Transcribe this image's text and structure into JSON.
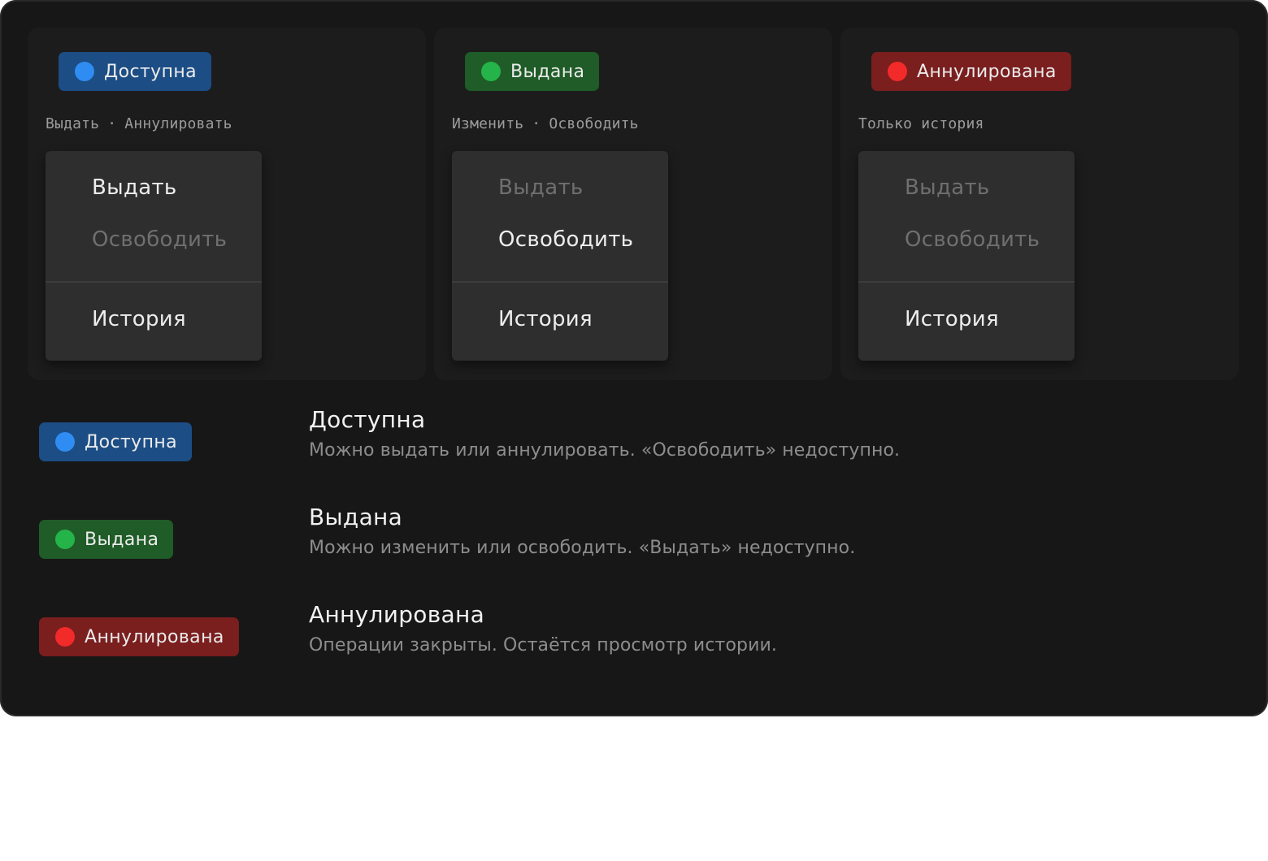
{
  "colors": {
    "background": "#171717",
    "card": "#1c1c1c",
    "menu": "#2e2e2e",
    "available": "#1c4d85",
    "available_dot": "#2f8cf2",
    "issued": "#1f5c27",
    "issued_dot": "#25b449",
    "cancelled": "#7a1e1e",
    "cancelled_dot": "#f22a2a"
  },
  "cards": [
    {
      "status": "Доступна",
      "status_color": "blue",
      "dot_icon": "status-dot-icon",
      "hint_parts": [
        "Выдать",
        "·",
        "Аннулировать"
      ],
      "menu": {
        "issue": "Выдать",
        "issue_enabled": true,
        "release": "Освободить",
        "release_enabled": false,
        "history": "История"
      }
    },
    {
      "status": "Выдана",
      "status_color": "green",
      "dot_icon": "status-dot-icon",
      "hint_parts": [
        "Изменить",
        "·",
        "Освободить"
      ],
      "menu": {
        "issue": "Выдать",
        "issue_enabled": false,
        "release": "Освободить",
        "release_enabled": true,
        "history": "История"
      }
    },
    {
      "status": "Аннулирована",
      "status_color": "red",
      "dot_icon": "status-dot-icon",
      "hint_parts": [
        "Только история"
      ],
      "menu": {
        "issue": "Выдать",
        "issue_enabled": false,
        "release": "Освободить",
        "release_enabled": false,
        "history": "История"
      }
    }
  ],
  "legend": [
    {
      "badge": "Доступна",
      "title": "Доступна",
      "description": "Можно выдать или аннулировать. «Освободить» недоступно."
    },
    {
      "badge": "Выдана",
      "title": "Выдана",
      "description": "Можно изменить или освободить. «Выдать» недоступно."
    },
    {
      "badge": "Аннулирована",
      "title": "Аннулирована",
      "description": "Операции закрыты. Остаётся просмотр истории."
    }
  ]
}
